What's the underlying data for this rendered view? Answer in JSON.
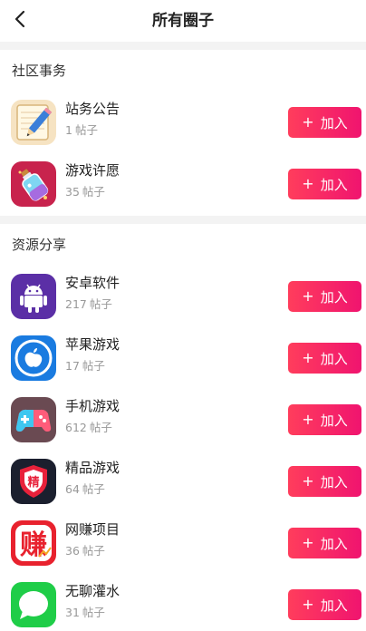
{
  "header": {
    "title": "所有圈子"
  },
  "sections": [
    {
      "title": "社区事务",
      "items": [
        {
          "name": "站务公告",
          "count": "1",
          "unit": "帖子",
          "join": "加入",
          "icon": "notepad-pencil-icon"
        },
        {
          "name": "游戏许愿",
          "count": "35",
          "unit": "帖子",
          "join": "加入",
          "icon": "wish-bottle-icon"
        }
      ]
    },
    {
      "title": "资源分享",
      "items": [
        {
          "name": "安卓软件",
          "count": "217",
          "unit": "帖子",
          "join": "加入",
          "icon": "android-icon"
        },
        {
          "name": "苹果游戏",
          "count": "17",
          "unit": "帖子",
          "join": "加入",
          "icon": "apple-icon"
        },
        {
          "name": "手机游戏",
          "count": "612",
          "unit": "帖子",
          "join": "加入",
          "icon": "gamepad-icon"
        },
        {
          "name": "精品游戏",
          "count": "64",
          "unit": "帖子",
          "join": "加入",
          "icon": "premium-shield-icon"
        },
        {
          "name": "网赚项目",
          "count": "36",
          "unit": "帖子",
          "join": "加入",
          "icon": "money-earn-icon"
        },
        {
          "name": "无聊灌水",
          "count": "31",
          "unit": "帖子",
          "join": "加入",
          "icon": "chat-bubble-icon"
        }
      ]
    }
  ],
  "colors": {
    "accent_start": "#ff3d5c",
    "accent_end": "#f0146f"
  }
}
